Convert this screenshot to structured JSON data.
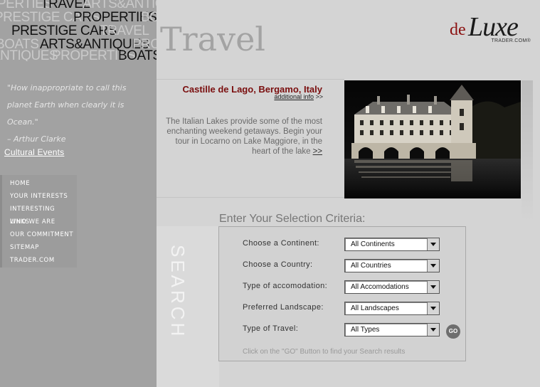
{
  "brand": {
    "de": "de",
    "luxe": "Luxe",
    "trader": "TRADER.COM®"
  },
  "wordcloud": {
    "dark": [
      "TRAVEL",
      "PROPERTIES",
      "PRESTIGE CARS",
      "ARTS&ANTIQUES",
      "BOATS"
    ],
    "ghost": [
      "PERTIES",
      "ARTS&ANTIQUES",
      "PRESTIGE CARS",
      "BO",
      "PRESTIGE CARS",
      "TRAVEL",
      "ARTS",
      "PRO",
      "BOATS",
      "ANTIQUES",
      "PROPERTIES"
    ]
  },
  "page_title": "Travel",
  "quote": {
    "line1": "\"How inappropriate to call this",
    "line2": "planet Earth when clearly it is Ocean.\"",
    "author": "– Arthur Clarke"
  },
  "sidebar": {
    "cultural_events": "Cultural Events",
    "nav": [
      "HOME",
      "YOUR INTERESTS",
      "INTERESTING LINKS",
      "WHO WE ARE",
      "OUR COMMITMENT",
      "SITEMAP",
      "TRADER.COM"
    ]
  },
  "feature": {
    "title": "Castille de Lago, Bergamo, Italy",
    "more_label": "additional info",
    "more_arrow": ">>",
    "text": "The Italian Lakes provide some of the most enchanting weekend getaways. Begin your tour in Locarno on Lake Maggiore, in the heart of the lake",
    "text_link": ">>"
  },
  "search": {
    "vertical_label": "SEARCH",
    "title": "Enter Your Selection Criteria:",
    "fields": [
      {
        "label": "Choose a Continent:",
        "value": "All Continents"
      },
      {
        "label": "Choose a Country:",
        "value": "All Countries"
      },
      {
        "label": "Type of accomodation:",
        "value": "All Accomodations"
      },
      {
        "label": "Preferred Landscape:",
        "value": "All Landscapes"
      },
      {
        "label": "Type of Travel:",
        "value": "All Types"
      }
    ],
    "go_label": "GO",
    "hint": "Click on the \"GO\" Button to find your Search results"
  },
  "colors": {
    "sidebar_bg": "#a2a2a2",
    "page_bg": "#d4d4d4",
    "feature_title": "#7a0e0e",
    "logo_de": "#8b1111"
  }
}
